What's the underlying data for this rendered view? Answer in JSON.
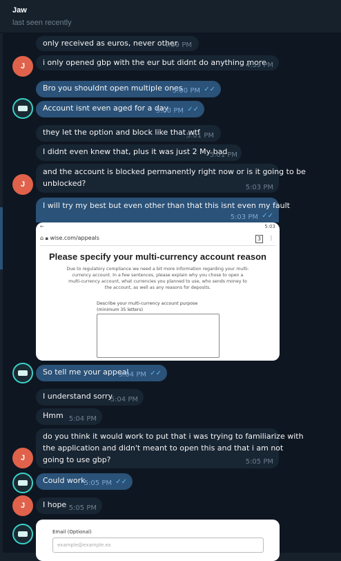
{
  "header": {
    "name": "Jaw",
    "status": "last seen recently"
  },
  "avatars": {
    "j_letter": "J"
  },
  "messages": [
    {
      "text": "only received as euros, never other",
      "time": "4:59 PM",
      "dir": "in"
    },
    {
      "text": "i only opened gbp with the eur but didnt do anything more",
      "time": "4:59 PM",
      "dir": "in"
    },
    {
      "text": "Bro you shouldnt open multiple ones",
      "time": "5:00 PM",
      "dir": "out"
    },
    {
      "text": "Account isnt even aged for a day",
      "time": "5:00 PM",
      "dir": "out"
    },
    {
      "text": "they let the option and block like that wtf",
      "time": "5:01 PM",
      "dir": "in"
    },
    {
      "text": "I didnt even knew that, plus it was just 2 My bad",
      "time": "5:01 PM",
      "dir": "in"
    },
    {
      "text": "and the account is blocked permanently right now or is it going to be",
      "text2": "unblocked?",
      "time": "5:03 PM",
      "dir": "in"
    },
    {
      "text": "I will try my best but even other than that this isnt even my fault",
      "time": "5:03 PM",
      "dir": "out"
    },
    {
      "text": "So tell me your appeal",
      "time": "5:04 PM",
      "dir": "out"
    },
    {
      "text": "I understand sorry",
      "time": "5:04 PM",
      "dir": "in"
    },
    {
      "text": "Hmm",
      "time": "5:04 PM",
      "dir": "in"
    },
    {
      "text": "do you think it would work to put that i was trying to familiarize with",
      "text2": "the application and didn't meant to open this and that i am not",
      "text3": "going to use gbp?",
      "time": "5:05 PM",
      "dir": "in"
    },
    {
      "text": "Could work",
      "time": "5:05 PM",
      "dir": "out"
    },
    {
      "text": "I hope",
      "time": "5:05 PM",
      "dir": "in"
    }
  ],
  "screenshot": {
    "status_time": "5:03",
    "url": "wise.com/appeals",
    "tab_count": "3",
    "title": "Please specify your multi-currency account reason",
    "body": "Due to regulatory compliance we need a bit more information regarding your multi-currency account. In a few sentences, please explain why you chose to open a multi-currency account, what currencies you planned to use, who sends money to the account, as well as any reasons for deposits.",
    "field_label": "Describe your multi-currency account purpose (minimum 35 letters)"
  },
  "screenshot2": {
    "label": "Email (Optional)",
    "placeholder": "example@example.ex"
  }
}
